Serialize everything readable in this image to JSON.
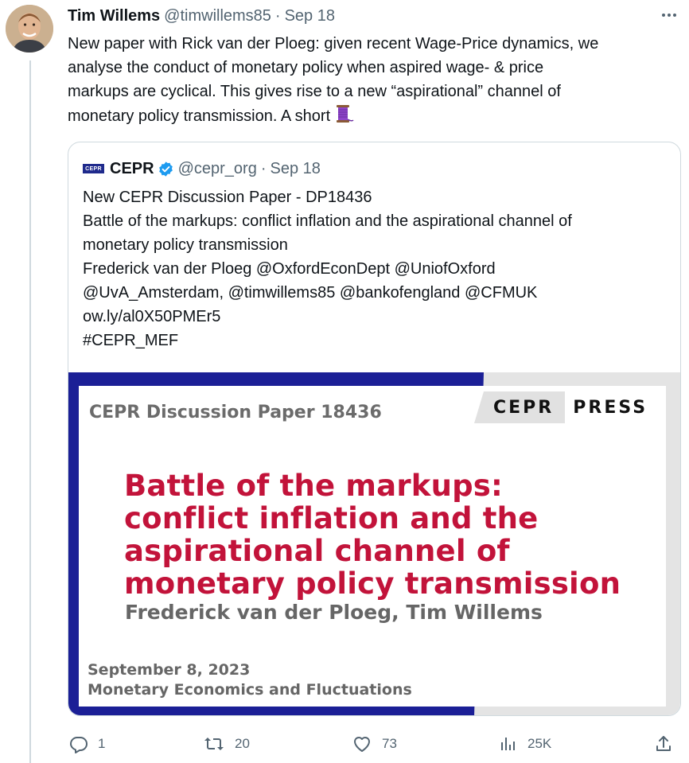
{
  "tweet": {
    "author_name": "Tim Willems",
    "author_handle": "@timwillems85",
    "separator": "·",
    "timestamp": "Sep 18",
    "text_lines": [
      "New paper with Rick van der Ploeg: given recent Wage-Price dynamics, we",
      "analyse the conduct of monetary policy when aspired wage- & price",
      "markups are cyclical. This gives rise to a new “aspirational” channel of",
      "monetary policy transmission. A short"
    ],
    "trailing_emoji_icon": "thread-spool-icon"
  },
  "quote": {
    "logo_text": "CEPR",
    "name": "CEPR",
    "handle": "@cepr_org",
    "separator": "·",
    "timestamp": "Sep 18",
    "text_lines": [
      "New CEPR Discussion Paper - DP18436",
      "Battle of the markups: conflict inflation and the aspirational channel of",
      "monetary policy transmission",
      "Frederick van der Ploeg @OxfordEconDept @UniofOxford",
      "@UvA_Amsterdam, @timwillems85 @bankofengland @CFMUK",
      "ow.ly/al0X50PMEr5",
      "#CEPR_MEF"
    ],
    "image": {
      "series": "CEPR Discussion Paper 18436",
      "press_left": "CEPR",
      "press_right": "PRESS",
      "title_lines": [
        "Battle of the markups:",
        "conflict inflation and the",
        "aspirational channel of",
        "monetary policy transmission"
      ],
      "authors": "Frederick van der Ploeg, Tim Willems",
      "date": "September 8, 2023",
      "program": "Monetary Economics and Fluctuations"
    }
  },
  "actions": {
    "reply_count": "1",
    "retweet_count": "20",
    "like_count": "73",
    "views_count": "25K"
  },
  "colors": {
    "text": "#0f1419",
    "secondary": "#536471",
    "border": "#cfd9de",
    "verified": "#1d9bf0",
    "title_red": "#c2133a",
    "frame_blue": "#1b1f96"
  }
}
